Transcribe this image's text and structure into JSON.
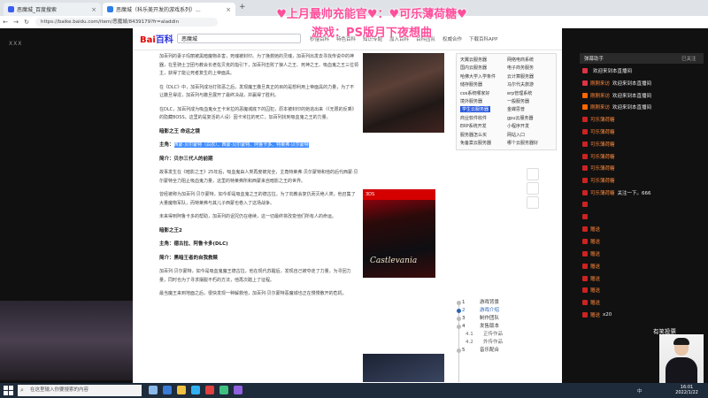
{
  "browser": {
    "tabs": [
      {
        "label": "恶魔城_百度搜索",
        "color": "#3b5cf0"
      },
      {
        "label": "恶魔城（科乐美开发的游戏系列）...",
        "color": "#2b7de9"
      }
    ],
    "url": "https://baike.baidu.com/item/恶魔城/8439179?fr=aladdin"
  },
  "overlay": {
    "line1": "♥上月最帅充能官♥：♥可乐薄荷糖♥",
    "line2": "游戏：PS版月下夜想曲"
  },
  "corner": {
    "line1": "",
    "line2": "ⅩⅩⅩ"
  },
  "baike": {
    "logo_red": "Bai",
    "logo_blue": "百科",
    "search_value": "恶魔城",
    "header_links": [
      "秒懂百科",
      "特色百科",
      "知识专题",
      "加入百科",
      "百科团队",
      "权威合作",
      "下载百科APP"
    ]
  },
  "article": {
    "paragraphs": [
      "加百列的妻子玛丽被黑暗魔物杀害，死魂被封印。为了挽救她的灵魂，加百列出发去寻找传说中的神器，在圣骑士卫团与教会长老佐贝克的指引下，加百列击败了狼人之王、死神之王、吸血鬼之王三位领主，获得了能让死者复生的上帝面具。",
      "在《DLC》中，加百列成功打败恶之后，发现魔王撒旦真正的目的是想利用上帝面具的力量，为了不让撒旦得逞，加百列与撒旦展开了最终决战，并赢得了胜利。",
      "在DLC，加百列成为吸血鬼女王卡米拉的恶魔城底下的囚犯，原本被封印的她逃出来（《无限的反乘》的隐藏BOSS，这里的是复活的人设）因卡米拉的死亡，加百列找到吸血鬼之王的力量。"
    ],
    "section1_title": "暗影之王 命运之镜",
    "section1_chars_label": "主角：",
    "section1_chars": "西蒙·贝尔蒙特（白衣）、西蒙·贝尔蒙特、阿鲁卡多、特莱弗·贝尔蒙特",
    "section1_sub": "简介：贝尔三代人的前期",
    "paragraphs2": [
      "故事发生在《暗影之王》25年后，吸血鬼由人类再度被完全，主角特莱弗·贝尔蒙特和他的后代西蒙·贝尔蒙特全力阻止吸血鬼力量，这里的特莱弗所和西蒙来自暗影之王的世界。",
      "曾经被称为加百列·贝尔蒙特，如今却是吸血鬼之王的德古拉。为了向教会复仇而灭绝人类，他召集了大量魔物军队，而特莱弗与其儿子西蒙也卷入了这场战争。",
      "未来得到阿鲁卡多的帮助，加百列的诅咒仍在继续，这一切最终将改变他们所有人的命运。"
    ],
    "section2_title": "暗影之王2",
    "section2_chars": "主角：德古拉、阿鲁卡多(DLC)",
    "section2_sub": "简介：黑暗王者的自我救赎",
    "paragraphs3": [
      "加百列·贝尔蒙特，如今是吸血鬼魔王德古拉，他在现代苏醒后，发现自己被夺走了力量，为寻回力量，同时也为了寻求摆脱不朽的方法，他再次踏上了征程。",
      "最当魔王来到地面之后，很快发现一种解救他，加百列·贝尔蒙特恶魔城也正在慢慢散开的危机。"
    ],
    "cover_platform": "3DS",
    "cover_title": "Castlevania"
  },
  "sidebox": {
    "left": [
      "天翼云服务器",
      "国内云服务器",
      "哈佛大学入学条件",
      "储存服务器",
      "cos系统哪家好",
      "境外服务器",
      "学生云服务器",
      "商业软件收件",
      "ERP系统开发",
      "服务器怎么买",
      "免备案云服务器"
    ],
    "right": [
      "网络电商系统",
      "电子商务服务",
      "云计算服务器",
      "马尔代夫旅游",
      "erp管理系统",
      "一般服务器",
      "金蝶思普",
      "gpu云服务器",
      "小程序开发",
      "网站入口",
      "哪个云服务器好"
    ],
    "selected_index": 6
  },
  "toc": {
    "items": [
      {
        "num": "1",
        "label": "游戏背景",
        "level": 1
      },
      {
        "num": "2",
        "label": "游戏介绍",
        "level": 1
      },
      {
        "num": "3",
        "label": "制作团队",
        "level": 1
      },
      {
        "num": "4",
        "label": "发售版本",
        "level": 1
      },
      {
        "num": "4.1",
        "label": "正传作品",
        "level": 2
      },
      {
        "num": "4.2",
        "label": "外传作品",
        "level": 2
      },
      {
        "num": "5",
        "label": "音乐配合",
        "level": 1
      }
    ],
    "active_index": 1
  },
  "chat": {
    "header": "弹幕助手",
    "header_right": "已关注",
    "rows": [
      {
        "name": "",
        "text": "欢迎来到本直播间",
        "icon": "#d34"
      },
      {
        "name": "刚刚来访",
        "text": "欢迎来到本直播间",
        "icon": "#d34"
      },
      {
        "name": "刚刚来访",
        "text": "欢迎来到本直播间",
        "icon": "#f60"
      },
      {
        "name": "刚刚来访",
        "text": "欢迎来到本直播间",
        "icon": "#f60"
      },
      {
        "name": "可乐薄荷糖",
        "text": "",
        "icon": "#c22"
      },
      {
        "name": "可乐薄荷糖",
        "text": "",
        "icon": "#c22"
      },
      {
        "name": "可乐薄荷糖",
        "text": "",
        "icon": "#c22"
      },
      {
        "name": "可乐薄荷糖",
        "text": "",
        "icon": "#c22"
      },
      {
        "name": "可乐薄荷糖",
        "text": "",
        "icon": "#c22"
      },
      {
        "name": "可乐薄荷糖",
        "text": "",
        "icon": "#c22"
      },
      {
        "name": "可乐薄荷糖",
        "text": "关注一下。666",
        "icon": "#c22"
      },
      {
        "name": "",
        "text": "",
        "icon": "#c22"
      },
      {
        "name": "",
        "text": "",
        "icon": "#c22"
      },
      {
        "name": "赠送",
        "text": "",
        "icon": "#c22"
      },
      {
        "name": "赠送",
        "text": "",
        "icon": "#c22"
      },
      {
        "name": "赠送",
        "text": "",
        "icon": "#c22"
      },
      {
        "name": "赠送",
        "text": "",
        "icon": "#c22"
      },
      {
        "name": "赠送",
        "text": "",
        "icon": "#c22"
      },
      {
        "name": "赠送",
        "text": "",
        "icon": "#c22"
      },
      {
        "name": "赠送",
        "text": "",
        "icon": "#c22"
      },
      {
        "name": "赠送",
        "text": "x20",
        "icon": "#c22"
      }
    ],
    "streamer_label": "有笑投票"
  },
  "left_caption": "",
  "taskbar": {
    "search_placeholder": "在这里输入你要搜索的内容",
    "tray": "中",
    "time": "16:01",
    "date": "2022/1/22"
  }
}
